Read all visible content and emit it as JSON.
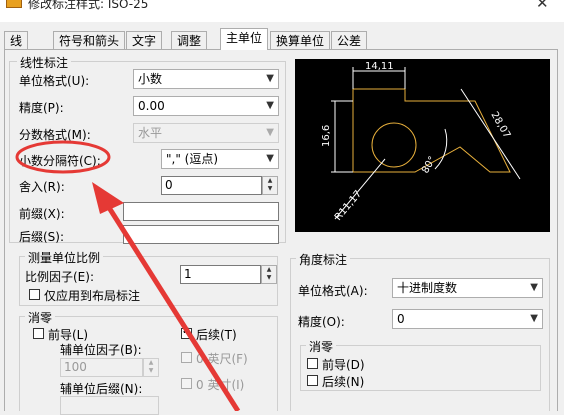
{
  "window": {
    "title": "修改标注样式: ISO-25",
    "close": "✕"
  },
  "tabs": [
    {
      "label": "线"
    },
    {
      "label": "符号和箭头"
    },
    {
      "label": "文字"
    },
    {
      "label": "调整"
    },
    {
      "label": "主单位"
    },
    {
      "label": "换算单位"
    },
    {
      "label": "公差"
    }
  ],
  "linear": {
    "legend": "线性标注",
    "unit_format": {
      "label": "单位格式(U):",
      "value": "小数"
    },
    "precision": {
      "label": "精度(P):",
      "value": "0.00"
    },
    "fraction_format": {
      "label": "分数格式(M):",
      "value": "水平"
    },
    "decimal_separator": {
      "label": "小数分隔符(C):",
      "value": "\",\" (逗点)"
    },
    "round_off": {
      "label": "舍入(R):",
      "value": "0"
    },
    "prefix": {
      "label": "前缀(X):",
      "value": ""
    },
    "suffix": {
      "label": "后缀(S):",
      "value": ""
    }
  },
  "measurement_scale": {
    "legend": "测量单位比例",
    "scale_factor": {
      "label": "比例因子(E):",
      "value": "1"
    },
    "layout_only": {
      "label": "仅应用到布局标注"
    }
  },
  "zero_suppression": {
    "legend": "消零",
    "leading": {
      "label": "前导(L)"
    },
    "trailing": {
      "label": "后续(T)"
    },
    "sub_unit_factor": {
      "label": "辅单位因子(B):",
      "value": "100"
    },
    "sub_unit_suffix": {
      "label": "辅单位后缀(N):"
    },
    "feet": {
      "label": "0 英尺(F)"
    },
    "inches": {
      "label": "0 英寸(I)"
    }
  },
  "angular": {
    "legend": "角度标注",
    "unit_format": {
      "label": "单位格式(A):",
      "value": "十进制度数"
    },
    "precision": {
      "label": "精度(O):",
      "value": "0"
    },
    "zero": {
      "legend": "消零",
      "leading": {
        "label": "前导(D)"
      },
      "trailing": {
        "label": "后续(N)"
      }
    }
  },
  "preview_dims": {
    "top": "14,11",
    "left": "16,6",
    "right": "28,07",
    "angle": "80°",
    "radius": "R11,17"
  },
  "colors": {
    "preview_bg": "#000000",
    "preview_lines": "#e8b03c",
    "preview_text": "#ffffff",
    "annotation": "#e53935"
  }
}
